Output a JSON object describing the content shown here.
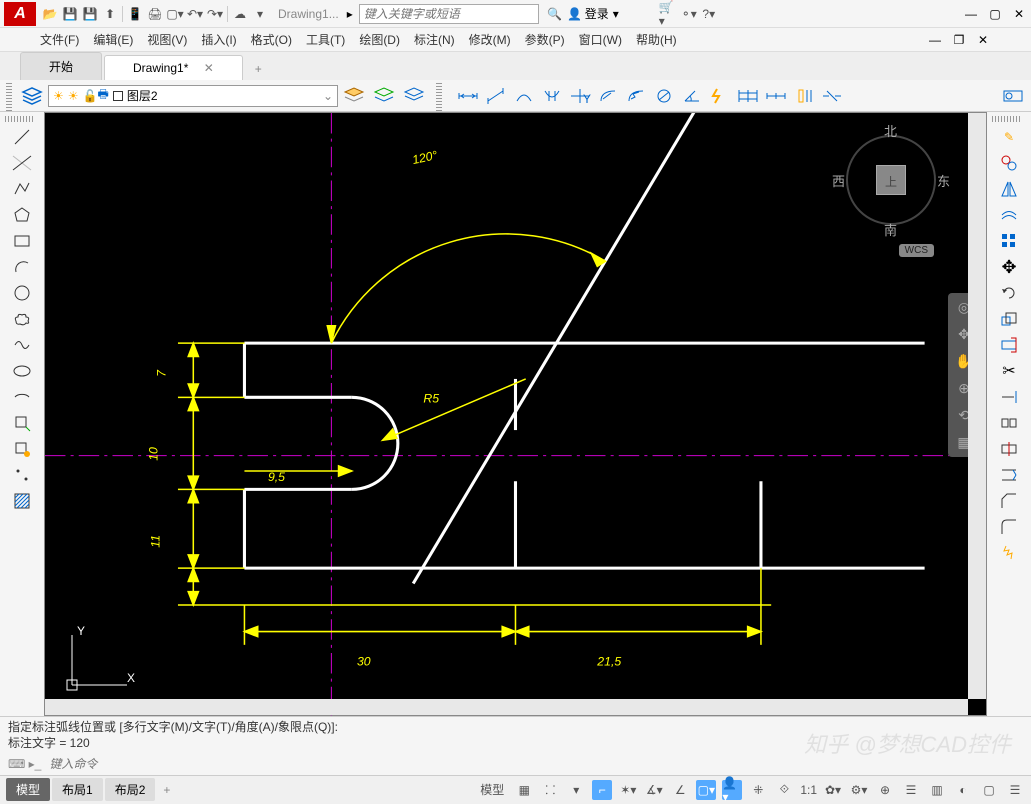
{
  "app": {
    "logo_letter": "A",
    "doc_title": "Drawing1...",
    "search_placeholder": "键入关键字或短语",
    "login": "登录"
  },
  "menus": {
    "file": "文件(F)",
    "edit": "编辑(E)",
    "view": "视图(V)",
    "insert": "插入(I)",
    "format": "格式(O)",
    "tools": "工具(T)",
    "draw": "绘图(D)",
    "dim": "标注(N)",
    "modify": "修改(M)",
    "param": "参数(P)",
    "window": "窗口(W)",
    "help": "帮助(H)"
  },
  "tabs": {
    "start": "开始",
    "drawing": "Drawing1*"
  },
  "layer": {
    "name": "图层2"
  },
  "compass": {
    "n": "北",
    "s": "南",
    "e": "东",
    "w": "西",
    "top": "上",
    "wcs": "WCS"
  },
  "ucs": {
    "x": "X",
    "y": "Y"
  },
  "drawing_dims": {
    "angle": "120°",
    "radius": "R5",
    "d7": "7",
    "d10": "10",
    "d11": "11",
    "d95": "9,5",
    "d30": "30",
    "d215": "21,5"
  },
  "cmd": {
    "line1": "指定标注弧线位置或 [多行文字(M)/文字(T)/角度(A)/象限点(Q)]:",
    "line2": "标注文字 = 120",
    "input_placeholder": "键入命令"
  },
  "status": {
    "model": "模型",
    "layout1": "布局1",
    "layout2": "布局2",
    "model2": "模型",
    "scale": "1:1"
  },
  "watermark": "知乎 @梦想CAD控件"
}
